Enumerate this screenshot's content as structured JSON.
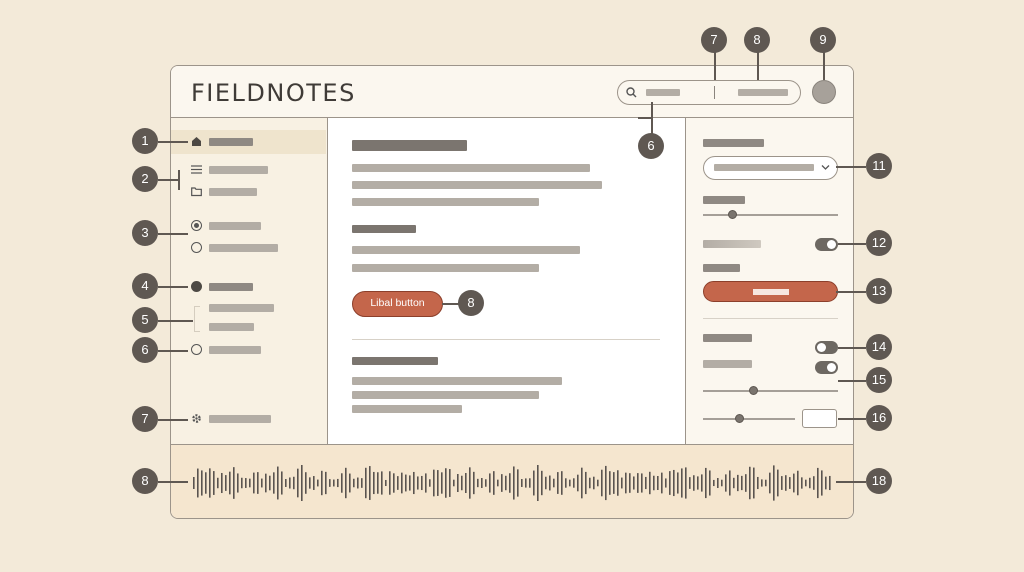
{
  "app": {
    "logo": "FIELDNOTES"
  },
  "main": {
    "primary_button_label": "Libal button"
  },
  "callouts": {
    "sidebar_home": "1",
    "sidebar_list_group": "2",
    "sidebar_radio_group": "3",
    "sidebar_dot_item": "4",
    "sidebar_sub_items": "5",
    "sidebar_radio_item": "6",
    "sidebar_settings": "7",
    "search_left": "7",
    "search_right": "8",
    "avatar": "9",
    "search_field": "6",
    "primary_button": "8",
    "dropdown": "11",
    "toggle_1": "12",
    "wide_button": "13",
    "toggle_2": "14",
    "toggle_3": "15",
    "number_box": "16",
    "waveform_left": "8",
    "waveform_right": "18"
  },
  "icons": {
    "home": "home-icon",
    "list": "list-icon",
    "folder": "folder-icon",
    "search": "search-icon",
    "chevron": "chevron-down-icon",
    "gear": "gear-icon"
  },
  "colors": {
    "accent": "#c4664b",
    "callout": "#5f5852",
    "background": "#f3ead9"
  },
  "controls": {
    "slider_1_level": 0.22,
    "slider_2_level": 0.38,
    "slider_3_level": 0.4,
    "toggle_1_on": true,
    "toggle_2_on": false,
    "toggle_3_on": true
  }
}
